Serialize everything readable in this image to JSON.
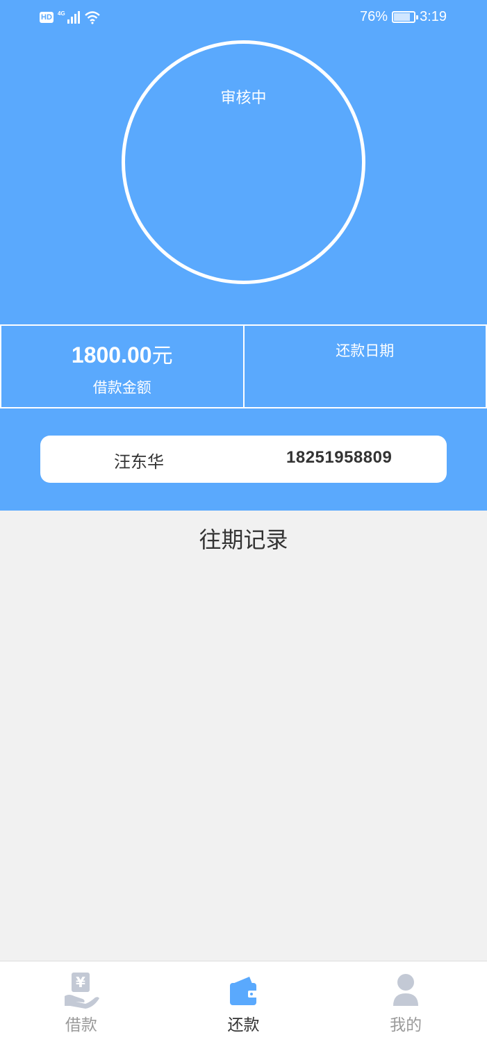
{
  "status_bar": {
    "hd": "HD",
    "network": "4G",
    "battery_percent": "76%",
    "time": "3:19"
  },
  "status_circle": {
    "label": "审核中"
  },
  "loan_info": {
    "amount": "1800.00",
    "unit": "元",
    "amount_label": "借款金额",
    "repay_date_label": "还款日期"
  },
  "user_card": {
    "name": "汪东华",
    "phone": "18251958809"
  },
  "history": {
    "title": "往期记录"
  },
  "tabbar": {
    "tabs": [
      {
        "label": "借款",
        "icon": "loan-hand-yen-icon",
        "active": false
      },
      {
        "label": "还款",
        "icon": "wallet-icon",
        "active": true
      },
      {
        "label": "我的",
        "icon": "user-icon",
        "active": false
      }
    ]
  },
  "colors": {
    "primary": "#5aa9fd",
    "background": "#f1f1f1",
    "tab_inactive": "#9a9a9a",
    "tab_active": "#333333"
  }
}
